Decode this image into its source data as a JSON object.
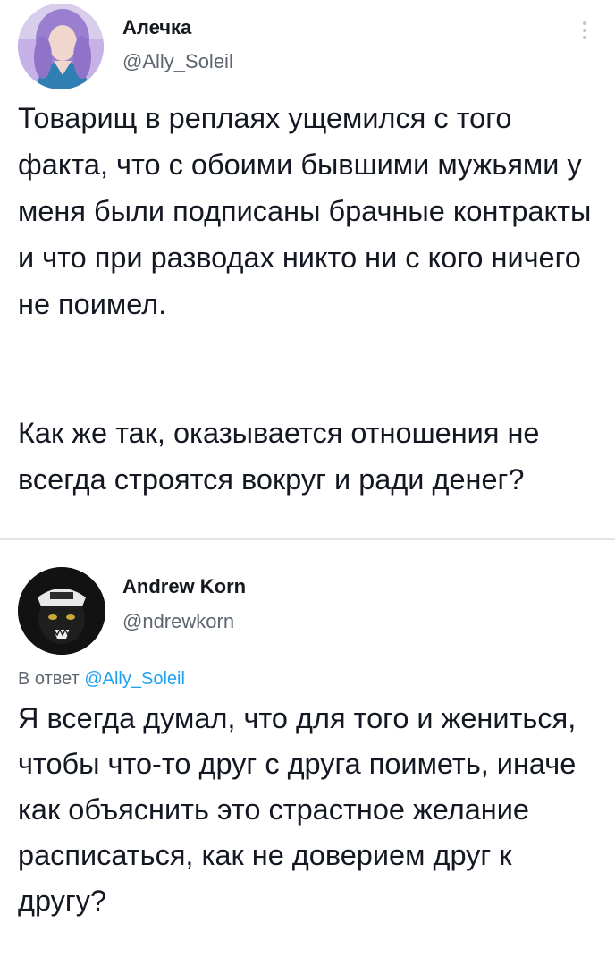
{
  "tweets": [
    {
      "display_name": "Алечка",
      "handle": "@Ally_Soleil",
      "paragraphs": [
        "Товарищ в реплаях ущемился с того факта, что с обоими бывшими мужьями у меня были подписаны брачные контракты и что при разводах никто ни с кого ничего не поимел.",
        "Как же так, оказывается отношения не всегда строятся вокруг и ради денег?"
      ],
      "avatar_icon": "user-avatar-purple-hair",
      "menu_icon": "more-vertical-icon"
    },
    {
      "display_name": "Andrew Korn",
      "handle": "@ndrewkorn",
      "reply_prefix": "В ответ",
      "reply_mention": "@Ally_Soleil",
      "paragraphs": [
        "Я всегда думал, что для того и жениться, чтобы что-то друг с друга поиметь, иначе как объяснить это страстное желание расписаться, как не доверием друг к другу?"
      ],
      "avatar_icon": "panther-cap-avatar"
    }
  ],
  "colors": {
    "text": "#141823",
    "secondary": "#5d6670",
    "link": "#1da1f2",
    "divider": "#e3e6e9"
  }
}
